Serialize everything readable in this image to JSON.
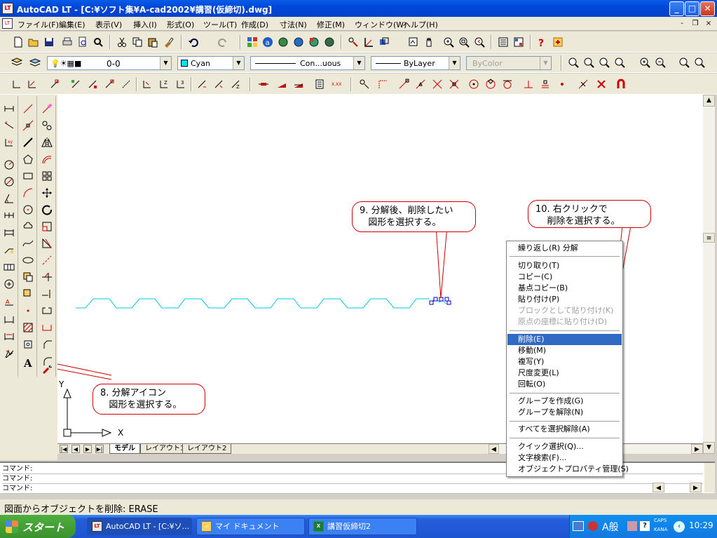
{
  "window": {
    "title": "AutoCAD LT - [C:¥ソフト集¥A-cad2002¥講習(仮締切).dwg]",
    "app_icon": "LT",
    "minimize": "_",
    "maximize": "□",
    "close": "✕"
  },
  "menu": {
    "mdi_icon": "LT",
    "items": [
      "ファイル(F)",
      "編集(E)",
      "表示(V)",
      "挿入(I)",
      "形式(O)",
      "ツール(T)",
      "作成(D)",
      "寸法(N)",
      "修正(M)",
      "ウィンドウ(W)",
      "ヘルプ(H)"
    ],
    "mdi_min": "-",
    "mdi_restore": "❐",
    "mdi_close": "×"
  },
  "properties_bar": {
    "layer": "0-0",
    "color": "Cyan",
    "color_swatch": "#00e5ff",
    "linetype": "Con...uous",
    "lineweight": "ByLayer",
    "plotstyle": "ByColor"
  },
  "layout_tabs": {
    "nav": [
      "|◀",
      "◀",
      "▶",
      "▶|"
    ],
    "tabs": [
      "モデル",
      "レイアウト1",
      "レイアウト2"
    ]
  },
  "ucs": {
    "x": "X",
    "y": "Y"
  },
  "command": {
    "lines": [
      "コマンド:",
      "コマンド:",
      "コマンド:"
    ],
    "status": "図面からオブジェクトを削除:  ERASE"
  },
  "context_menu": {
    "sections": [
      [
        {
          "label": "繰り返し(R) 分解",
          "enabled": true
        }
      ],
      [
        {
          "label": "切り取り(T)",
          "enabled": true
        },
        {
          "label": "コピー(C)",
          "enabled": true
        },
        {
          "label": "基点コピー(B)",
          "enabled": true
        },
        {
          "label": "貼り付け(P)",
          "enabled": true
        },
        {
          "label": "ブロックとして貼り付け(K)",
          "enabled": false
        },
        {
          "label": "原点の座標に貼り付け(D)",
          "enabled": false
        }
      ],
      [
        {
          "label": "削除(E)",
          "enabled": true,
          "selected": true
        },
        {
          "label": "移動(M)",
          "enabled": true
        },
        {
          "label": "複写(Y)",
          "enabled": true
        },
        {
          "label": "尺度変更(L)",
          "enabled": true
        },
        {
          "label": "回転(O)",
          "enabled": true
        }
      ],
      [
        {
          "label": "グループを作成(G)",
          "enabled": true
        },
        {
          "label": "グループを解除(N)",
          "enabled": true
        }
      ],
      [
        {
          "label": "すべてを選択解除(A)",
          "enabled": true
        }
      ],
      [
        {
          "label": "クイック選択(Q)...",
          "enabled": true
        },
        {
          "label": "文字検索(F)...",
          "enabled": true
        },
        {
          "label": "オブジェクトプロパティ管理(S)",
          "enabled": true
        }
      ]
    ]
  },
  "callouts": {
    "explode": "8. 分解アイコン\n   図形を選択する。",
    "select": "9. 分解後、削除したい\n   図形を選択する。",
    "rightclick": "10. 右クリックで\n    削除を選択する。"
  },
  "taskbar": {
    "start": "スタート",
    "tasks": [
      {
        "label": "AutoCAD LT - [C:¥ソ...",
        "icon": "LT"
      },
      {
        "label": "マイ ドキュメント",
        "icon": "📁"
      },
      {
        "label": "講習仮締切2",
        "icon": "X"
      }
    ],
    "ime": "A般",
    "caps": "CAPS",
    "kana": "KANA",
    "clock": "10:29"
  },
  "colors": {
    "accent": "#316ac5",
    "titlebar": "#0047d9",
    "callout_border": "#cc0000",
    "drawing_line": "#00c8e6",
    "grip": "#0000c8"
  }
}
